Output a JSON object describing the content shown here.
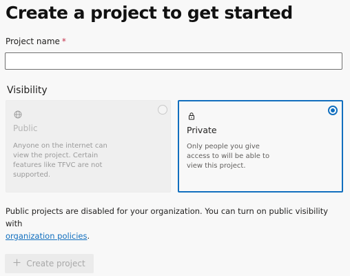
{
  "page": {
    "title": "Create a project to get started"
  },
  "project_name": {
    "label": "Project name",
    "required_mark": "*",
    "value": "",
    "placeholder": ""
  },
  "visibility": {
    "label": "Visibility",
    "options": [
      {
        "title": "Public",
        "icon": "globe-icon",
        "description": "Anyone on the internet can view the project. Certain features like TFVC are not supported.",
        "selected": false,
        "disabled": true
      },
      {
        "title": "Private",
        "icon": "lock-icon",
        "description": "Only people you give access to will be able to view this project.",
        "selected": true,
        "disabled": false
      }
    ]
  },
  "notice": {
    "text": "Public projects are disabled for your organization. You can turn on public visibility with",
    "link": "organization policies",
    "suffix": "."
  },
  "create_button": {
    "label": "Create project",
    "icon": "plus-icon",
    "disabled": true
  },
  "colors": {
    "accent": "#106ebe",
    "required": "#c4314b",
    "background": "#f8f8f8"
  }
}
